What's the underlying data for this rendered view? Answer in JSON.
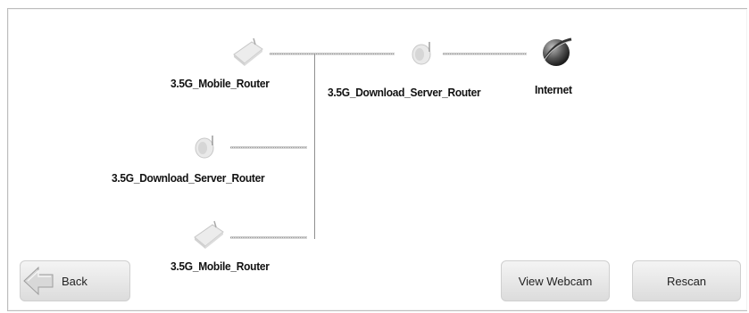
{
  "topology": {
    "internet_label": "Internet",
    "gateway_label": "3.5G_Download_Server_Router",
    "router1_label": "3.5G_Mobile_Router",
    "router2_label": "3.5G_Download_Server_Router",
    "router3_label": "3.5G_Mobile_Router"
  },
  "buttons": {
    "back": "Back",
    "view_webcam": "View Webcam",
    "rescan": "Rescan"
  },
  "icons": {
    "internet": "globe-icon",
    "gateway": "router-round-icon",
    "router1": "router-icon",
    "router2": "router-round-icon",
    "router3": "router-icon",
    "back": "back-arrow-icon"
  }
}
